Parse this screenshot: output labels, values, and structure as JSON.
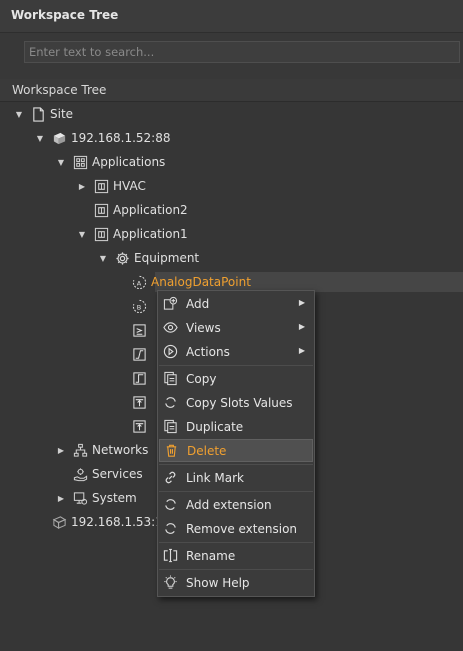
{
  "panel": {
    "title": "Workspace Tree"
  },
  "search": {
    "placeholder": "Enter text to search..."
  },
  "tree": {
    "header": "Workspace Tree",
    "nodes": [
      {
        "label": "Site"
      },
      {
        "label": "192.168.1.52:88"
      },
      {
        "label": "Applications"
      },
      {
        "label": "HVAC"
      },
      {
        "label": "Application2"
      },
      {
        "label": "Application1"
      },
      {
        "label": "Equipment"
      },
      {
        "label": "AnalogDataPoint"
      },
      {
        "label": "Networks"
      },
      {
        "label": "Services"
      },
      {
        "label": "System"
      },
      {
        "label": "192.168.1.53:1"
      }
    ]
  },
  "context_menu": {
    "items": [
      {
        "label": "Add"
      },
      {
        "label": "Views"
      },
      {
        "label": "Actions"
      },
      {
        "label": "Copy"
      },
      {
        "label": "Copy Slots Values"
      },
      {
        "label": "Duplicate"
      },
      {
        "label": "Delete"
      },
      {
        "label": "Link Mark"
      },
      {
        "label": "Add extension"
      },
      {
        "label": "Remove extension"
      },
      {
        "label": "Rename"
      },
      {
        "label": "Show Help"
      }
    ]
  },
  "colors": {
    "accent": "#f0a030",
    "background": "#363636",
    "text": "#e0e0e0"
  }
}
